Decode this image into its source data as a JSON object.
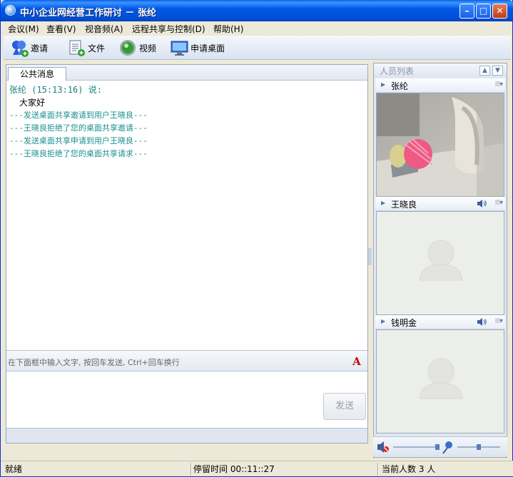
{
  "window": {
    "title": "中小企业网经营工作研讨 － 张纶"
  },
  "menu": [
    {
      "label": "会议(M)"
    },
    {
      "label": "查看(V)"
    },
    {
      "label": "视音频(A)"
    },
    {
      "label": "远程共享与控制(D)"
    },
    {
      "label": "帮助(H)"
    }
  ],
  "toolbar": {
    "invite": "邀请",
    "file": "文件",
    "video": "视频",
    "desktop": "申请桌面"
  },
  "chat": {
    "tab": "公共消息",
    "message_header": "张纶 (15:13:16) 说:",
    "message_body": "大家好",
    "system_lines": [
      "---发送桌面共享邀请到用户王晓良---",
      "---王晓良拒绝了您的桌面共享邀请---",
      "---发送桌面共享申请到用户王晓良---",
      "---王晓良拒绝了您的桌面共享请求---"
    ],
    "input_hint": "在下面框中输入文字, 按回车发送, Ctrl+回车换行",
    "font_button": "A",
    "send": "发送"
  },
  "people": {
    "title": "人员列表",
    "members": [
      {
        "name": "张纶"
      },
      {
        "name": "王晓良"
      },
      {
        "name": "钱明金"
      }
    ]
  },
  "status": {
    "ready": "就绪",
    "stay_time": "停留时间 00::11::27",
    "count": "当前人数 3 人"
  }
}
